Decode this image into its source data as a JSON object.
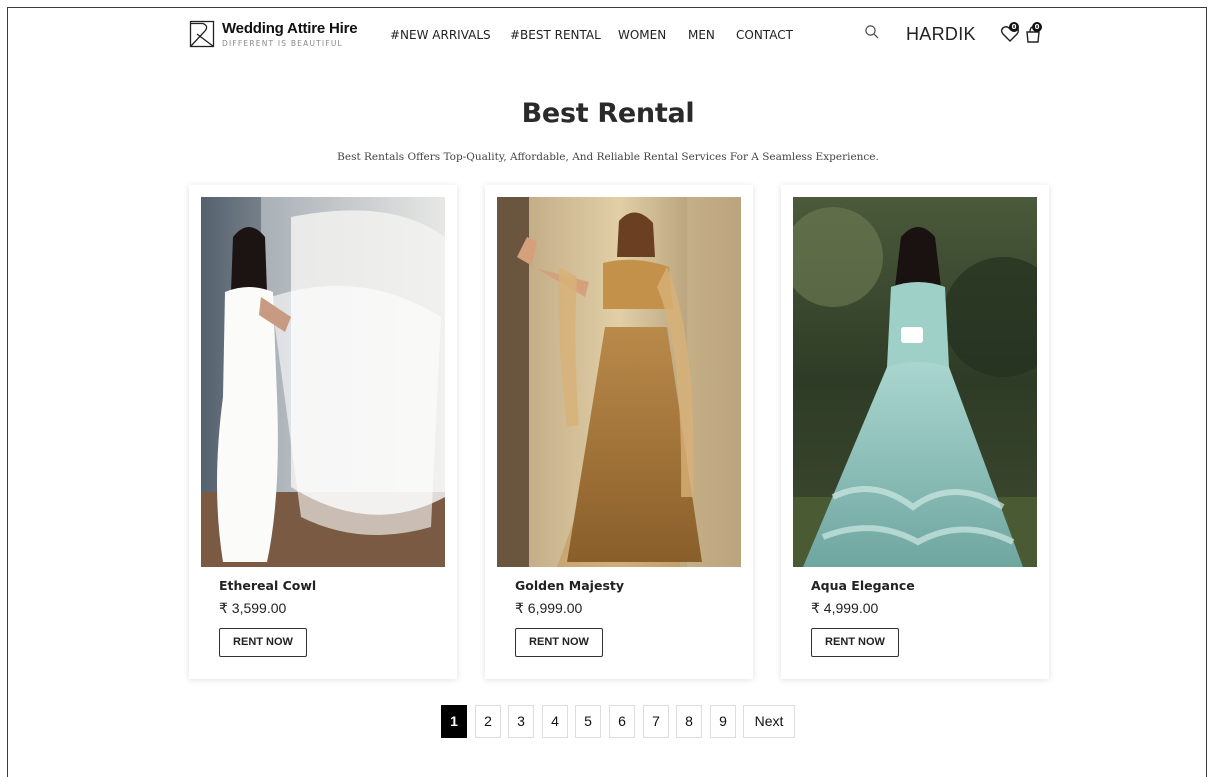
{
  "header": {
    "brand_title": "Wedding Attire Hire",
    "brand_tagline": "DIFFERENT IS BEAUTIFUL",
    "nav": [
      "#NEW ARRIVALS",
      "#BEST RENTAL",
      "WOMEN",
      "MEN",
      "CONTACT"
    ],
    "username": "HARDIK",
    "wishlist_count": "0",
    "cart_count": "0"
  },
  "main": {
    "title": "Best Rental",
    "subtitle": "Best Rentals Offers Top-Quality, Affordable, And Reliable Rental Services For A Seamless Experience."
  },
  "products": [
    {
      "name": "Ethereal Cowl",
      "price": "₹ 3,599.00",
      "button": "RENT NOW"
    },
    {
      "name": "Golden Majesty",
      "price": "₹ 6,999.00",
      "button": "RENT NOW"
    },
    {
      "name": "Aqua Elegance",
      "price": "₹ 4,999.00",
      "button": "RENT NOW"
    }
  ],
  "pagination": {
    "pages": [
      "1",
      "2",
      "3",
      "4",
      "5",
      "6",
      "7",
      "8",
      "9"
    ],
    "active": "1",
    "next_label": "Next"
  },
  "colors": {
    "accent": "#000000",
    "text": "#222222"
  }
}
